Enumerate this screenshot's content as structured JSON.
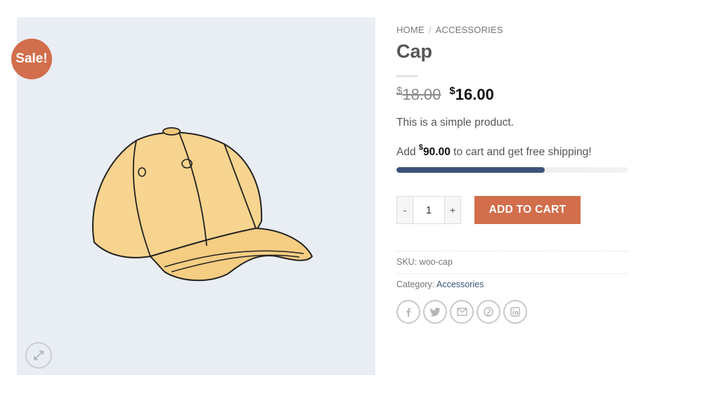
{
  "product": {
    "badge": "Sale!",
    "image_alt": "Cap illustration",
    "title": "Cap",
    "currency": "$",
    "old_price": "18.00",
    "new_price": "16.00",
    "description": "This is a simple product."
  },
  "breadcrumb": {
    "home": "HOME",
    "separator": "/",
    "category": "ACCESSORIES"
  },
  "shipping": {
    "prefix": "Add",
    "currency": "$",
    "amount": "90.00",
    "suffix": "to cart and get free shipping!",
    "progress_fraction": 0.64
  },
  "cart": {
    "minus": "-",
    "plus": "+",
    "quantity": "1",
    "add_label": "ADD TO CART"
  },
  "meta": {
    "sku_label": "SKU:",
    "sku_value": "woo-cap",
    "category_label": "Category:",
    "category_value": "Accessories"
  },
  "share_icons": [
    "facebook-icon",
    "twitter-icon",
    "email-icon",
    "pinterest-icon",
    "linkedin-icon"
  ],
  "colors": {
    "accent": "#d26e4b",
    "progress": "#3c5377",
    "gallery_bg": "#e9eef4"
  }
}
